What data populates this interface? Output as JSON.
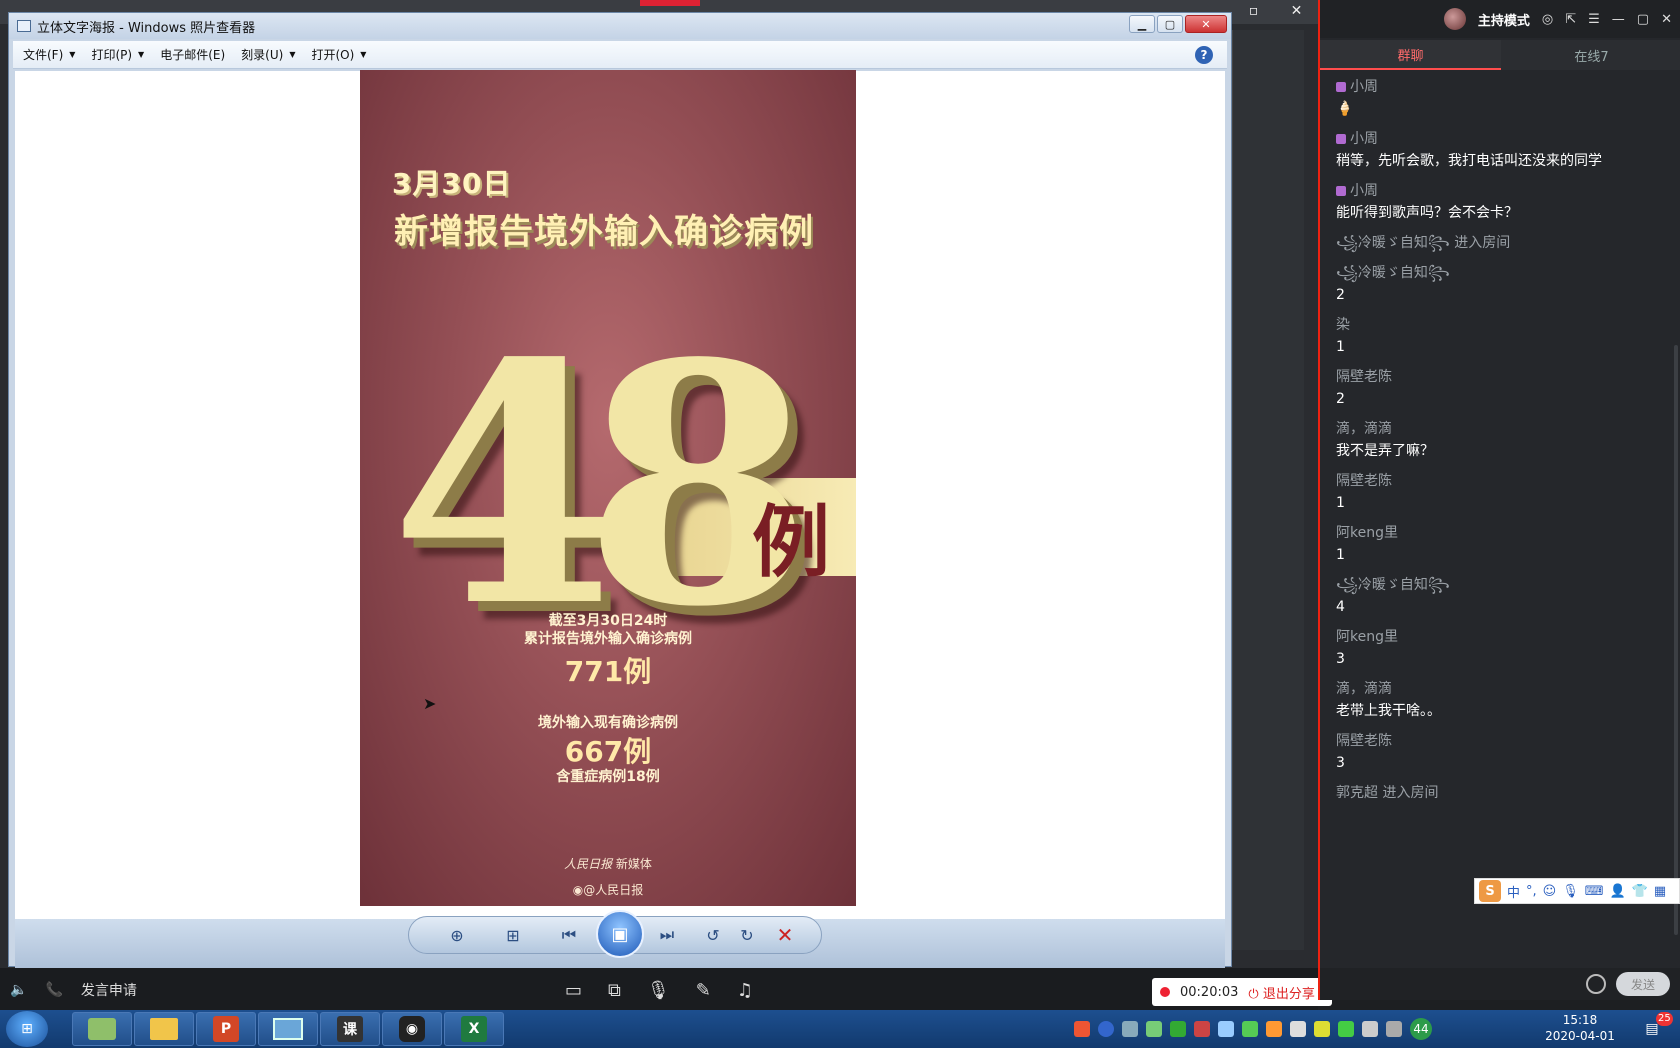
{
  "viewer": {
    "title": "立体文字海报 - Windows 照片查看器",
    "menu": [
      {
        "label": "文件(F)",
        "has_caret": true
      },
      {
        "label": "打印(P)",
        "has_caret": true
      },
      {
        "label": "电子邮件(E)",
        "has_caret": false
      },
      {
        "label": "刻录(U)",
        "has_caret": true
      },
      {
        "label": "打开(O)",
        "has_caret": true
      }
    ],
    "help_label": "?"
  },
  "poster": {
    "date": "3月30日",
    "title": "新增报告境外输入确诊病例",
    "big_number": "48",
    "big_unit": "例",
    "cumulative_label_1": "截至3月30日24时",
    "cumulative_label_2": "累计报告境外输入确诊病例",
    "cumulative_value": "771例",
    "current_label": "境外输入现有确诊病例",
    "current_value": "667例",
    "severe_label": "含重症病例18例",
    "media_credit": "新媒体",
    "weibo": "@人民日报"
  },
  "host": {
    "apply_speak": "发言申请",
    "timer": "00:20:03",
    "exit_share": "退出分享"
  },
  "chat": {
    "mode": "主持模式",
    "tabs": [
      "群聊",
      "在线7"
    ],
    "messages": [
      {
        "who": "小周",
        "text": "🍦",
        "vip": true,
        "join": false
      },
      {
        "who": "小周",
        "text": "稍等，先听会歌，我打电话叫还没来的同学",
        "vip": true,
        "join": false
      },
      {
        "who": "小周",
        "text": "能听得到歌声吗？会不会卡？",
        "vip": true,
        "join": false
      },
      {
        "who": "꧁冷暖ゞ自知꧂",
        "text": "进入房间",
        "vip": false,
        "join": true
      },
      {
        "who": "꧁冷暖ゞ自知꧂",
        "text": "2",
        "vip": false,
        "join": false
      },
      {
        "who": "染",
        "text": "1",
        "vip": false,
        "join": false
      },
      {
        "who": "隔壁老陈",
        "text": "2",
        "vip": false,
        "join": false
      },
      {
        "who": "滴，滴滴",
        "text": "我不是弄了嘛？",
        "vip": false,
        "join": false
      },
      {
        "who": "隔壁老陈",
        "text": "1",
        "vip": false,
        "join": false
      },
      {
        "who": "阿keng里",
        "text": "1",
        "vip": false,
        "join": false
      },
      {
        "who": "꧁冷暖ゞ自知꧂",
        "text": "4",
        "vip": false,
        "join": false
      },
      {
        "who": "阿keng里",
        "text": "3",
        "vip": false,
        "join": false
      },
      {
        "who": "滴，滴滴",
        "text": "老带上我干啥。。",
        "vip": false,
        "join": false
      },
      {
        "who": "隔壁老陈",
        "text": "3",
        "vip": false,
        "join": false
      },
      {
        "who": "郭克超",
        "text": "进入房间",
        "vip": false,
        "join": true
      }
    ],
    "send_label": "发送"
  },
  "ime": {
    "logo": "S",
    "mode": "中"
  },
  "taskbar": {
    "apps": [
      "",
      "",
      "",
      "",
      "课",
      "",
      ""
    ],
    "tray_badge": "44",
    "time": "15:18",
    "date": "2020-04-01",
    "notify_badge": "25"
  },
  "colors": {
    "accent_red": "#e22222",
    "poster_bg": "#944f55",
    "poster_gold": "#f2e6a6"
  }
}
